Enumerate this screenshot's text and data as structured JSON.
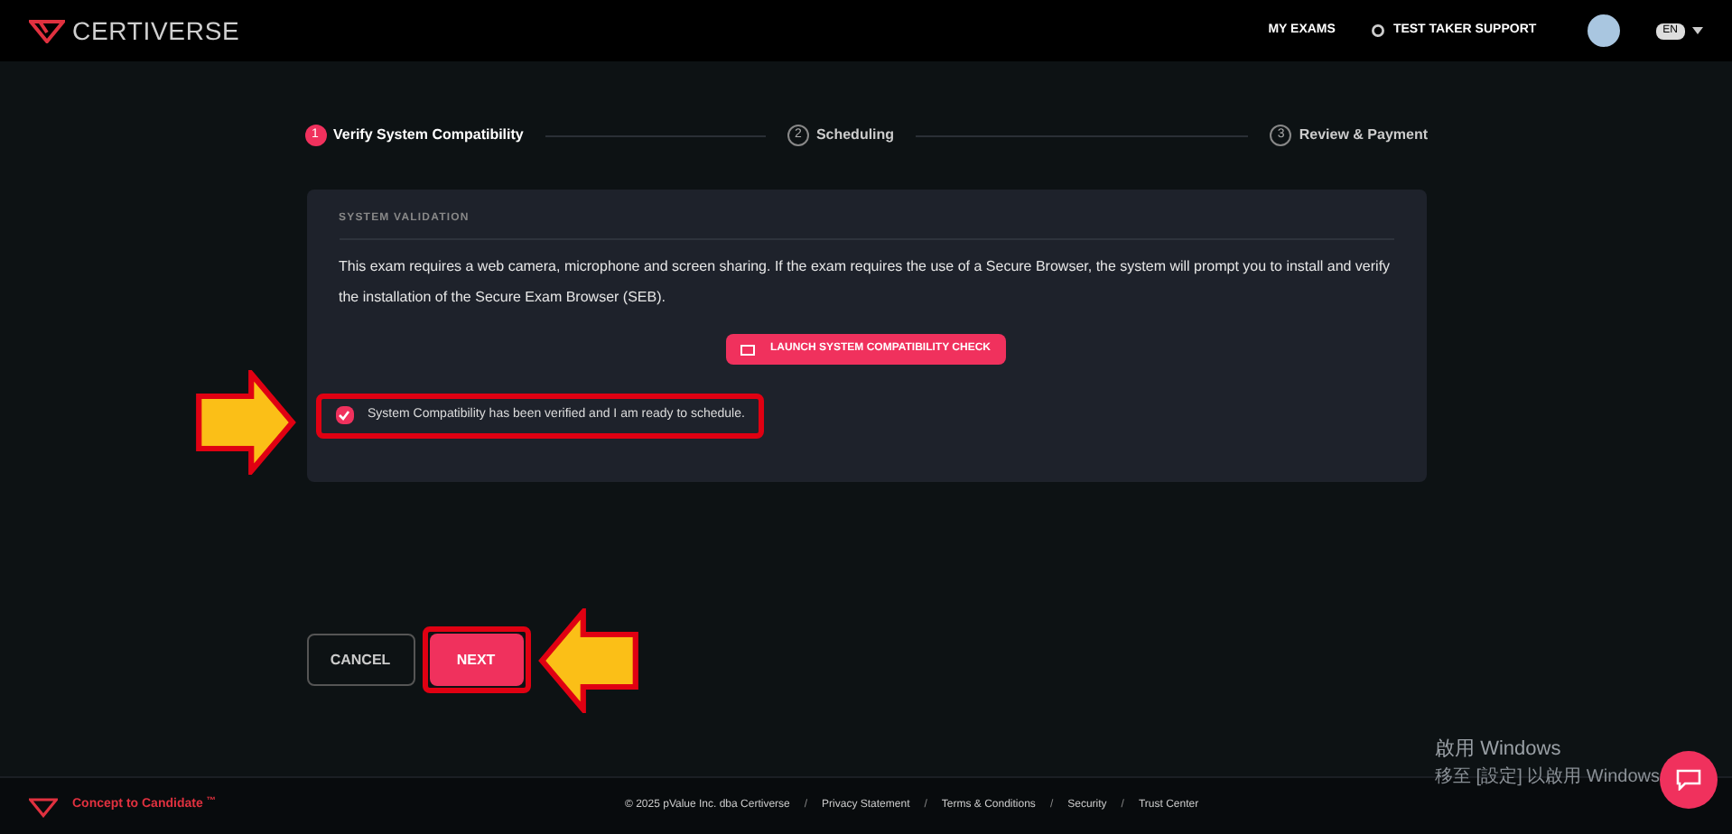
{
  "header": {
    "logo": "CERTIVERSE",
    "nav": [
      {
        "label": "MY EXAMS",
        "kind": "link"
      },
      {
        "label": "TEST TAKER SUPPORT",
        "kind": "support"
      }
    ],
    "language": "EN"
  },
  "steps": [
    {
      "number": "1",
      "label": "Verify System Compatibility",
      "selected": true
    },
    {
      "number": "2",
      "label": "Scheduling",
      "selected": false
    },
    {
      "number": "3",
      "label": "Review & Payment",
      "selected": false
    }
  ],
  "card": {
    "title": "SYSTEM VALIDATION",
    "text": "This exam requires a web camera, microphone and screen sharing. If the exam requires the use of a Secure Browser, the system will prompt you to install and verify the installation of the Secure Exam Browser (SEB).",
    "button": "LAUNCH SYSTEM COMPATIBILITY CHECK",
    "checkbox": {
      "label": "System Compatibility has been verified and I am ready to schedule.",
      "checked": true
    }
  },
  "actions": {
    "cancel": "CANCEL",
    "next": "NEXT"
  },
  "footer": {
    "tagline": "Concept to Candidate",
    "tm": "™",
    "items": [
      {
        "kind": "text",
        "label": "© 2025 pValue Inc. dba Certiverse"
      },
      {
        "kind": "separator",
        "label": "/"
      },
      {
        "kind": "link",
        "label": "Privacy Statement"
      },
      {
        "kind": "separator",
        "label": "/"
      },
      {
        "kind": "link",
        "label": "Terms & Conditions"
      },
      {
        "kind": "separator",
        "label": "/"
      },
      {
        "kind": "link",
        "label": "Security"
      },
      {
        "kind": "separator",
        "label": "/"
      },
      {
        "kind": "link",
        "label": "Trust Center"
      }
    ]
  },
  "os_notice": {
    "title": "啟用 Windows",
    "text": "移至 [設定] 以啟用 Windows"
  }
}
